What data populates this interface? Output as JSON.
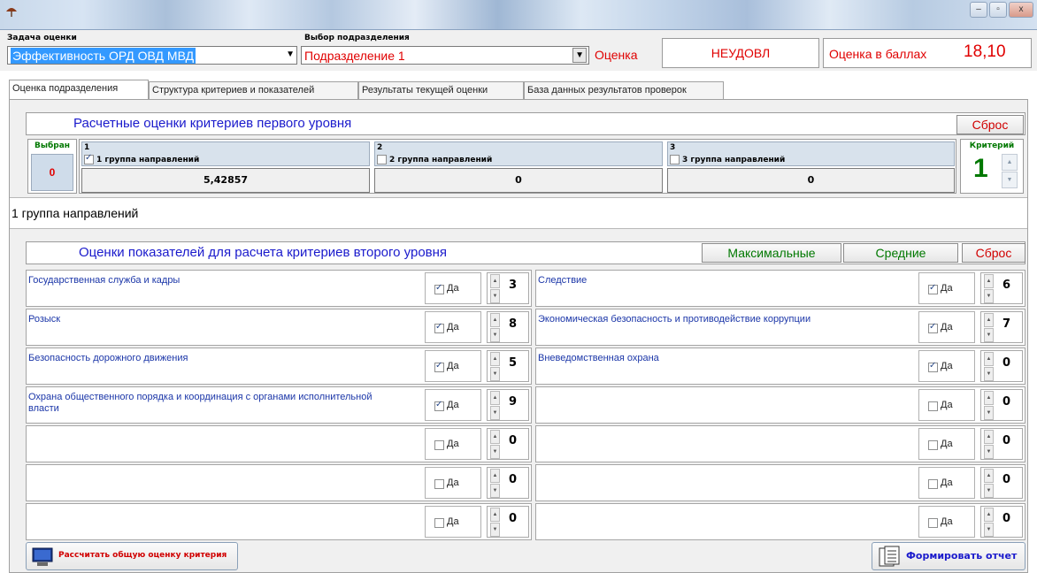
{
  "window": {
    "icon": "umbrella-icon",
    "controls": [
      "minimize-icon",
      "maximize-icon",
      "close-icon"
    ],
    "minimize_glyph": "–",
    "maximize_glyph": "▫",
    "close_glyph": "x"
  },
  "top": {
    "task_label": "Задача оценки",
    "task_value": "Эффективность ОРД ОВД МВД",
    "unit_label": "Выбор подразделения",
    "unit_value": "Подразделение 1",
    "grade_label": "Оценка",
    "grade_value": "НЕУДОВЛ",
    "score_label": "Оценка в баллах",
    "score_value": "18,10",
    "accent_red": "#e00000"
  },
  "tabs": [
    {
      "label": "Оценка подразделения",
      "active": true
    },
    {
      "label": "Структура критериев и показателей",
      "active": false
    },
    {
      "label": "Результаты текущей оценки",
      "active": false
    },
    {
      "label": "База данных результатов проверок",
      "active": false
    }
  ],
  "level1": {
    "title": "Расчетные оценки критериев первого уровня",
    "reset_label": "Сброс",
    "selected_label": "Выбран",
    "selected_value": "0",
    "criterion_label": "Критерий",
    "criterion_value": "1",
    "groups": [
      {
        "num": "1",
        "label": "1 группа направлений",
        "checked": true,
        "value": "5,42857"
      },
      {
        "num": "2",
        "label": "2 группа направлений",
        "checked": false,
        "value": "0"
      },
      {
        "num": "3",
        "label": "3 группа направлений",
        "checked": false,
        "value": "0"
      }
    ],
    "selected_group_text": "1 группа направлений"
  },
  "level2": {
    "title": "Оценки  показателей для расчета критериев второго уровня",
    "max_label": "Максимальные",
    "avg_label": "Средние",
    "reset_label": "Сброс",
    "yes_label": "Да",
    "left": [
      {
        "label": "Государственная служба и кадры",
        "checked": true,
        "value": "3"
      },
      {
        "label": "Розыск",
        "checked": true,
        "value": "8"
      },
      {
        "label": "Безопасность дорожного движения",
        "checked": true,
        "value": "5"
      },
      {
        "label": "Охрана общественного порядка и координация с органами исполнительной власти",
        "checked": true,
        "value": "9"
      },
      {
        "label": "",
        "checked": false,
        "value": "0"
      },
      {
        "label": "",
        "checked": false,
        "value": "0"
      },
      {
        "label": "",
        "checked": false,
        "value": "0"
      }
    ],
    "right": [
      {
        "label": "Следствие",
        "checked": true,
        "value": "6"
      },
      {
        "label": "Экономическая безопасность и противодействие коррупции",
        "checked": true,
        "value": "7"
      },
      {
        "label": "Вневедомственная охрана",
        "checked": true,
        "value": "0"
      },
      {
        "label": "",
        "checked": false,
        "value": "0"
      },
      {
        "label": "",
        "checked": false,
        "value": "0"
      },
      {
        "label": "",
        "checked": false,
        "value": "0"
      },
      {
        "label": "",
        "checked": false,
        "value": "0"
      }
    ]
  },
  "bottom": {
    "calc_label": "Рассчитать общую оценку критерия",
    "calc_icon": "computer-icon",
    "report_label": "Формировать отчет",
    "report_icon": "document-icon",
    "calc_color": "#d00000",
    "report_color": "#1a1acc"
  }
}
